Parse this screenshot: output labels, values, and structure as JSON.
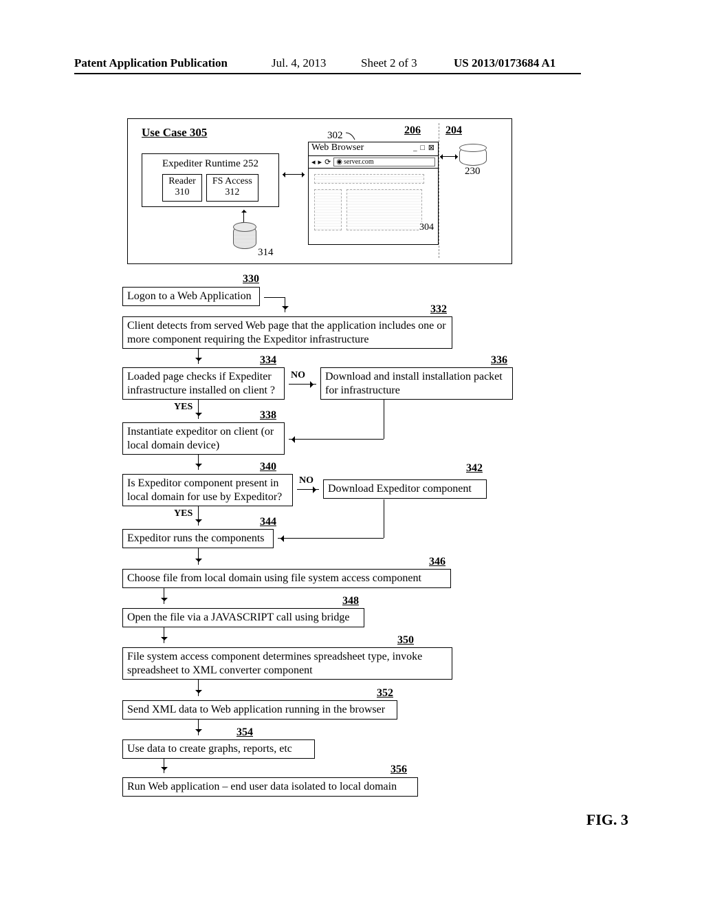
{
  "header": {
    "left": "Patent Application Publication",
    "date": "Jul. 4, 2013",
    "sheet": "Sheet 2 of 3",
    "pubno": "US 2013/0173684 A1"
  },
  "usecase": {
    "title": "Use Case 305",
    "expeditor": "Expediter Runtime 252",
    "reader": "Reader\n310",
    "fsaccess": "FS Access\n312",
    "cyl_label": "314",
    "browser_title": "Web Browser",
    "addr": "server.com",
    "label_302": "302",
    "label_304": "304",
    "label_206": "206",
    "label_204": "204",
    "label_230": "230"
  },
  "flow": {
    "n330": "Logon to a Web Application",
    "r330": "330",
    "n332": "Client detects from served Web page that the application includes one or more component requiring the Expeditor infrastructure",
    "r332": "332",
    "n334": "Loaded page checks if Expediter infrastructure installed on client ?",
    "r334": "334",
    "n336": "Download and install installation packet for infrastructure",
    "r336": "336",
    "n338": "Instantiate expeditor on client (or local domain device)",
    "r338": "338",
    "n340": "Is Expeditor component present in local domain for use by Expeditor?",
    "r340": "340",
    "n342": "Download Expeditor component",
    "r342": "342",
    "n344": "Expeditor runs the components",
    "r344": "344",
    "n346": "Choose file from local domain using file system access component",
    "r346": "346",
    "n348": "Open the file via a JAVASCRIPT call using bridge",
    "r348": "348",
    "n350": "File system access component determines spreadsheet type, invoke spreadsheet to XML converter component",
    "r350": "350",
    "n352": "Send XML data to Web application running in the browser",
    "r352": "352",
    "n354": "Use data to create graphs, reports, etc",
    "r354": "354",
    "n356": "Run Web application – end user data isolated to local domain",
    "r356": "356",
    "yes": "YES",
    "no": "NO"
  },
  "figure_label": "FIG. 3"
}
